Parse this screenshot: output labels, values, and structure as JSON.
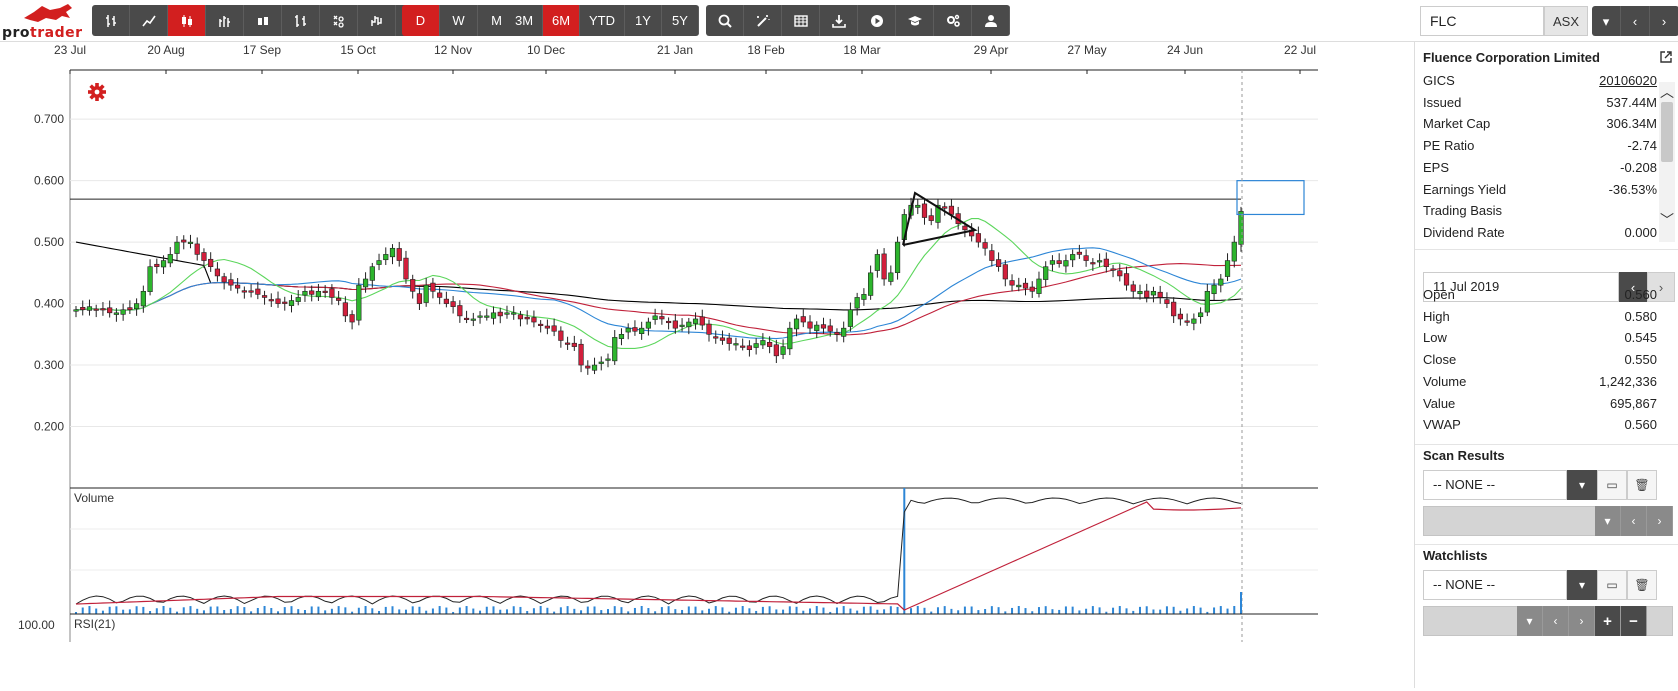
{
  "app": {
    "logo_text_a": "pro",
    "logo_text_b": "trader",
    "brand_color": "#d21f1f"
  },
  "toolbar": {
    "chart_types": [
      {
        "icon": "ohlc-bar-icon",
        "active": false
      },
      {
        "icon": "line-chart-icon",
        "active": false
      },
      {
        "icon": "candlestick-icon",
        "active": true
      },
      {
        "icon": "hlc-bar-icon",
        "active": false
      },
      {
        "icon": "hollow-candle-icon",
        "active": false
      },
      {
        "icon": "range-bar-icon",
        "active": false
      },
      {
        "icon": "point-figure-icon",
        "active": false
      },
      {
        "icon": "kagi-icon",
        "active": false
      },
      {
        "icon": "renko-icon",
        "active": false
      }
    ],
    "intervals": [
      {
        "label": "D",
        "active": true
      },
      {
        "label": "W",
        "active": false
      },
      {
        "label": "M",
        "active": false
      }
    ],
    "periods": [
      {
        "label": "3M",
        "active": false
      },
      {
        "label": "6M",
        "active": true
      },
      {
        "label": "YTD",
        "active": false
      },
      {
        "label": "1Y",
        "active": false
      },
      {
        "label": "5Y",
        "active": false
      }
    ],
    "tools": [
      {
        "icon": "search-icon"
      },
      {
        "icon": "magic-wand-icon"
      },
      {
        "icon": "table-icon"
      },
      {
        "icon": "download-icon"
      },
      {
        "icon": "play-icon"
      },
      {
        "icon": "graduation-cap-icon"
      },
      {
        "icon": "settings-cogs-icon"
      },
      {
        "icon": "user-icon"
      }
    ],
    "symbol": "FLC",
    "exchange": "ASX"
  },
  "chart_data": {
    "type": "candlestick",
    "x_tick_labels": [
      "23 Jul",
      "20 Aug",
      "17 Sep",
      "15 Oct",
      "12 Nov",
      "10 Dec",
      "21 Jan",
      "18 Feb",
      "18 Mar",
      "29 Apr",
      "27 May",
      "24 Jun",
      "22 Jul"
    ],
    "y_tick_labels": [
      "0.700",
      "0.600",
      "0.500",
      "0.400",
      "0.300",
      "0.200"
    ],
    "ylim": [
      0.1,
      0.78
    ],
    "resistance_level": 0.57,
    "current_box": [
      0.545,
      0.6
    ],
    "volume_label": "Volume",
    "rsi_label": "RSI(21)",
    "rsi_top_label": "100.00",
    "candle_up_color": "#2db52d",
    "candle_down_color": "#d21f3c",
    "ma_colors": [
      "#000000",
      "#c0213a",
      "#2d86d6",
      "#5cd65c"
    ],
    "closes": [
      0.39,
      0.39,
      0.395,
      0.39,
      0.39,
      0.385,
      0.385,
      0.39,
      0.39,
      0.4,
      0.42,
      0.46,
      0.46,
      0.47,
      0.48,
      0.5,
      0.5,
      0.5,
      0.48,
      0.47,
      0.46,
      0.445,
      0.435,
      0.43,
      0.425,
      0.42,
      0.42,
      0.415,
      0.41,
      0.405,
      0.4,
      0.4,
      0.405,
      0.41,
      0.42,
      0.415,
      0.42,
      0.42,
      0.41,
      0.405,
      0.38,
      0.37,
      0.43,
      0.44,
      0.46,
      0.47,
      0.48,
      0.49,
      0.47,
      0.44,
      0.42,
      0.4,
      0.43,
      0.42,
      0.41,
      0.4,
      0.395,
      0.38,
      0.375,
      0.375,
      0.38,
      0.38,
      0.385,
      0.38,
      0.385,
      0.385,
      0.375,
      0.375,
      0.37,
      0.365,
      0.36,
      0.355,
      0.34,
      0.335,
      0.33,
      0.3,
      0.295,
      0.3,
      0.305,
      0.31,
      0.345,
      0.35,
      0.36,
      0.355,
      0.36,
      0.37,
      0.38,
      0.375,
      0.37,
      0.36,
      0.365,
      0.37,
      0.375,
      0.365,
      0.35,
      0.345,
      0.34,
      0.335,
      0.335,
      0.33,
      0.325,
      0.335,
      0.34,
      0.33,
      0.315,
      0.33,
      0.36,
      0.375,
      0.37,
      0.36,
      0.365,
      0.36,
      0.355,
      0.35,
      0.36,
      0.39,
      0.41,
      0.415,
      0.45,
      0.48,
      0.44,
      0.45,
      0.5,
      0.545,
      0.56,
      0.56,
      0.54,
      0.535,
      0.56,
      0.555,
      0.545,
      0.53,
      0.52,
      0.51,
      0.5,
      0.49,
      0.47,
      0.46,
      0.44,
      0.43,
      0.43,
      0.425,
      0.42,
      0.44,
      0.46,
      0.47,
      0.465,
      0.47,
      0.48,
      0.48,
      0.47,
      0.465,
      0.47,
      0.46,
      0.455,
      0.445,
      0.43,
      0.42,
      0.42,
      0.41,
      0.42,
      0.41,
      0.4,
      0.38,
      0.375,
      0.37,
      0.375,
      0.385,
      0.42,
      0.43,
      0.44,
      0.47,
      0.5,
      0.55
    ],
    "volume_spike_index": 123
  },
  "sidebar": {
    "company": "Fluence Corporation Limited",
    "fundamentals": [
      {
        "label": "GICS",
        "value": "20106020",
        "link": true
      },
      {
        "label": "Issued",
        "value": "537.44M",
        "link": false
      },
      {
        "label": "Market Cap",
        "value": "306.34M",
        "link": false
      },
      {
        "label": "PE Ratio",
        "value": "-2.74",
        "link": false
      },
      {
        "label": "EPS",
        "value": "-0.208",
        "link": false
      },
      {
        "label": "Earnings Yield",
        "value": "-36.53%",
        "link": false
      },
      {
        "label": "Trading Basis",
        "value": "",
        "link": false
      },
      {
        "label": "Dividend Rate",
        "value": "0.000",
        "link": false
      }
    ],
    "date": "11 Jul 2019",
    "quote": [
      {
        "label": "Open",
        "value": "0.560"
      },
      {
        "label": "High",
        "value": "0.580"
      },
      {
        "label": "Low",
        "value": "0.545"
      },
      {
        "label": "Close",
        "value": "0.550"
      },
      {
        "label": "Volume",
        "value": "1,242,336"
      },
      {
        "label": "Value",
        "value": "695,867"
      },
      {
        "label": "VWAP",
        "value": "0.560"
      }
    ],
    "scan_title": "Scan Results",
    "scan_select": "-- NONE --",
    "watch_title": "Watchlists",
    "watch_select": "-- NONE --"
  }
}
